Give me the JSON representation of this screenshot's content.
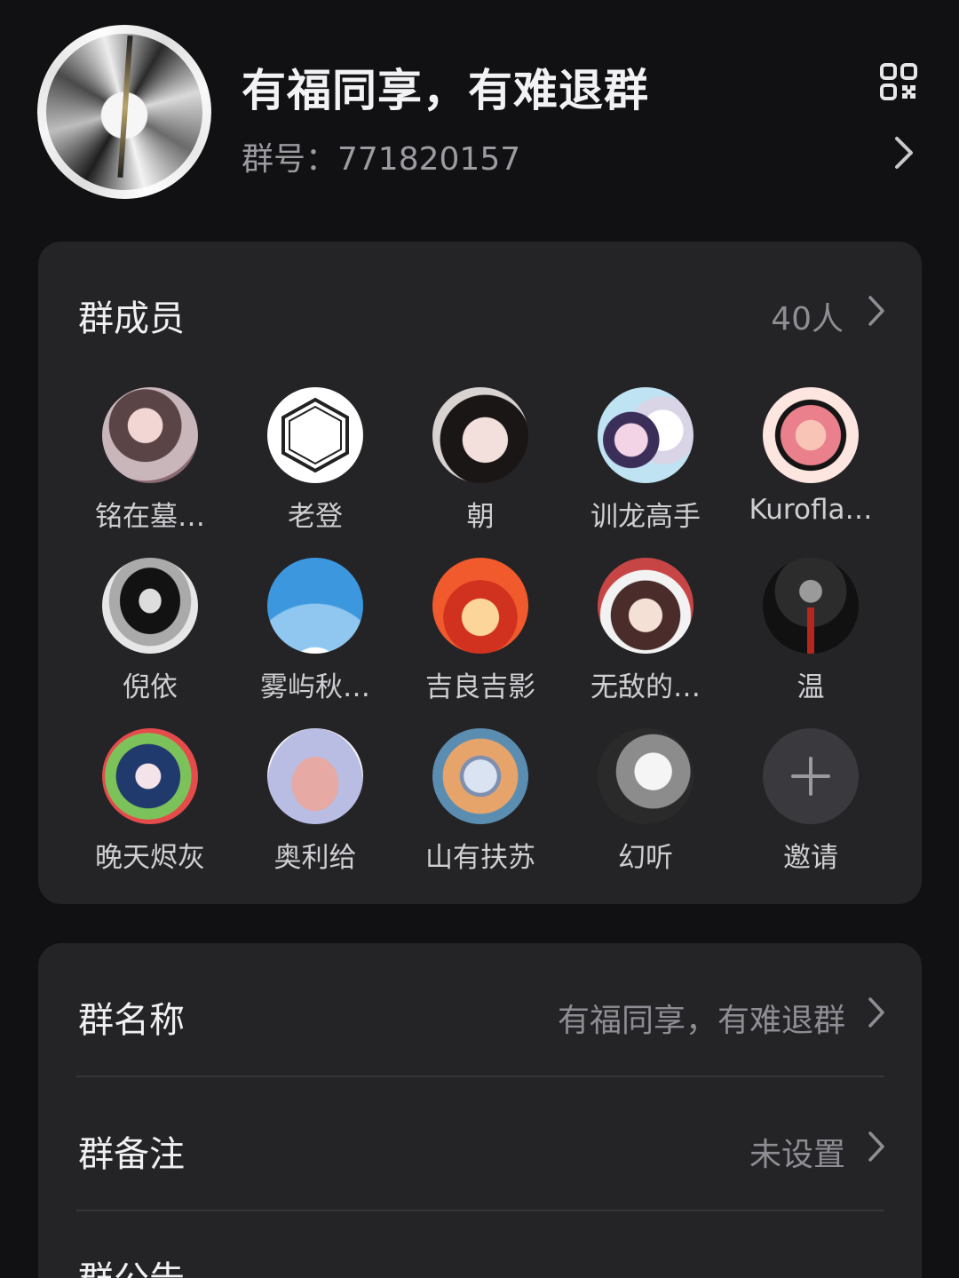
{
  "header": {
    "group_name": "有福同享，有难退群",
    "group_id_label": "群号：",
    "group_id": "771820157",
    "group_id_text": "群号：771820157"
  },
  "members_section": {
    "title": "群成员",
    "count": "40人",
    "members": [
      {
        "name": "铭在墓…"
      },
      {
        "name": "老登"
      },
      {
        "name": "朝"
      },
      {
        "name": "训龙高手"
      },
      {
        "name": "Kurofla…"
      },
      {
        "name": "倪依"
      },
      {
        "name": "雾屿秋…"
      },
      {
        "name": "吉良吉影"
      },
      {
        "name": "无敌的…"
      },
      {
        "name": "温"
      },
      {
        "name": "晚天烬灰"
      },
      {
        "name": "奥利给"
      },
      {
        "name": "山有扶苏"
      },
      {
        "name": "幻听"
      }
    ],
    "invite_label": "邀请"
  },
  "settings": {
    "group_name_row": {
      "label": "群名称",
      "value": "有福同享，有难退群"
    },
    "group_remark_row": {
      "label": "群备注",
      "value": "未设置"
    },
    "group_notice_row": {
      "label": "群公告"
    }
  },
  "colors": {
    "background": "#111113",
    "card": "#242427",
    "primary_text": "#f0f0f2",
    "secondary_text": "#8d8d93"
  },
  "icons": {
    "qr": "qr-code-icon",
    "chevron": "chevron-right-icon",
    "invite": "plus-icon"
  }
}
